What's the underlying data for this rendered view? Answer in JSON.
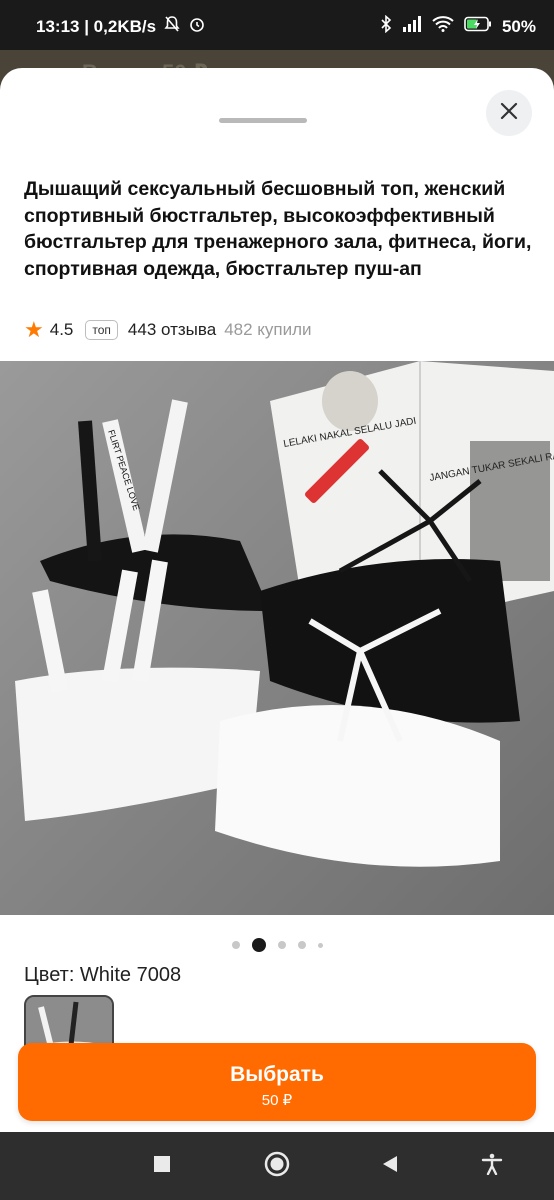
{
  "status_bar": {
    "time_net": "13:13 | 0,2KB/s",
    "battery": "50%"
  },
  "background_app": {
    "title": "Все до 50 ₽"
  },
  "product": {
    "title": "Дышащий сексуальный бесшовный топ, женский спортивный бюстгальтер, высокоэффективный бюстгальтер для тренажерного зала, фитнеса, йоги, спортивная одежда, бюстгальтер пуш-ап",
    "rating": "4.5",
    "badge": "топ",
    "reviews": "443 отзыва",
    "bought": "482 купили"
  },
  "gallery": {
    "photo_texts": {
      "strap": "FLIRT PEACE LOVE",
      "magazine_1": "LELAKI NAKAL SELALU JADI",
      "magazine_2": "JANGAN TUKAR SEKALI RANJANG"
    },
    "current_index": 1,
    "count": 5
  },
  "variant": {
    "color_label": "Цвет: White 7008"
  },
  "cta": {
    "label": "Выбрать",
    "price": "50 ₽"
  },
  "icons": {
    "close": "close-icon",
    "star": "star-icon",
    "nav_recent": "square-icon",
    "nav_home": "circle-icon",
    "nav_back": "triangle-back-icon",
    "nav_accessibility": "accessibility-icon"
  },
  "colors": {
    "accent": "#ff6b00",
    "star": "#ff7a00"
  }
}
